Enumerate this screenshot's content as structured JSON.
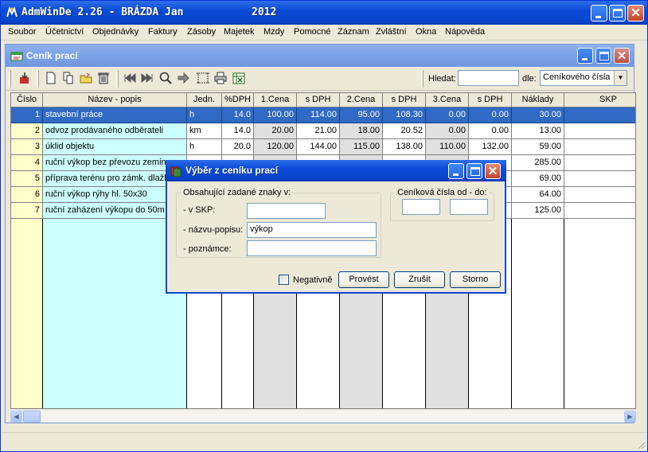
{
  "app": {
    "title": "AdmWinDe 2.26 - BRÁZDA Jan",
    "year": "2012"
  },
  "menu": [
    {
      "label": "Soubor"
    },
    {
      "label": "Účetnictví"
    },
    {
      "label": "Objednávky"
    },
    {
      "label": "Faktury"
    },
    {
      "label": "Zásoby"
    },
    {
      "label": "Majetek"
    },
    {
      "label": "Mzdy"
    },
    {
      "label": "Pomocné"
    },
    {
      "label": "Záznam"
    },
    {
      "label": "Zvláštní"
    },
    {
      "label": "Okna"
    },
    {
      "label": "Nápověda"
    }
  ],
  "child": {
    "title": "Ceník prací"
  },
  "toolbar": {
    "search_label": "Hledat:",
    "search_value": "",
    "by_label": "dle:",
    "by_value": "Ceníkového čísla"
  },
  "grid": {
    "columns": [
      "Číslo",
      "Název - popis",
      "Jedn.",
      "%DPH",
      "1.Cena",
      "s DPH",
      "2.Cena",
      "s DPH",
      "3.Cena",
      "s DPH",
      "Náklady",
      "SKP"
    ],
    "rows": [
      [
        "1",
        "stavební práce",
        "h",
        "14.0",
        "100.00",
        "114.00",
        "95.00",
        "108.30",
        "0.00",
        "0.00",
        "30.00",
        ""
      ],
      [
        "2",
        "odvoz prodávaného odběrateli",
        "km",
        "14.0",
        "20.00",
        "21.00",
        "18.00",
        "20.52",
        "0.00",
        "0.00",
        "13.00",
        ""
      ],
      [
        "3",
        "úklid objektu",
        "h",
        "20.0",
        "120.00",
        "144.00",
        "115.00",
        "138.00",
        "110.00",
        "132.00",
        "59.00",
        ""
      ],
      [
        "4",
        "ruční výkop bez převozu zeminy",
        "",
        "",
        "",
        "",
        "",
        "",
        "",
        "",
        "285.00",
        ""
      ],
      [
        "5",
        "příprava terénu pro zámk. dlažbu",
        "",
        "",
        "",
        "",
        "",
        "",
        "",
        "",
        "69.00",
        ""
      ],
      [
        "6",
        "ruční výkop rýhy hl. 50x30",
        "",
        "",
        "",
        "",
        "",
        "",
        "",
        "",
        "64.00",
        ""
      ],
      [
        "7",
        "ruční zaházení výkopu do 50m",
        "",
        "",
        "",
        "",
        "",
        "",
        "",
        "",
        "125.00",
        ""
      ]
    ],
    "selected_row": 0
  },
  "dialog": {
    "title": "Výběr z ceníku prací",
    "group1_label": "Obsahující zadané znaky v:",
    "skp_label": "- v SKP:",
    "skp_value": "",
    "name_label": "- názvu-popisu:",
    "name_value": "výkop",
    "note_label": "- poznámce:",
    "note_value": "",
    "group2_label": "Ceníková čísla od - do:",
    "from_value": "",
    "to_value": "",
    "negative_label": "Negativně",
    "negative_checked": false,
    "execute_button": "Provést",
    "cancel_filter_button": "Zrušit",
    "storno_button": "Storno"
  },
  "colors": {
    "titlebar": "#0a46cc",
    "selection": "#316ac5",
    "col_number_bg": "#ffffcc",
    "col_name_bg": "#ccffff",
    "col_gray_bg": "#e0e0e0"
  }
}
